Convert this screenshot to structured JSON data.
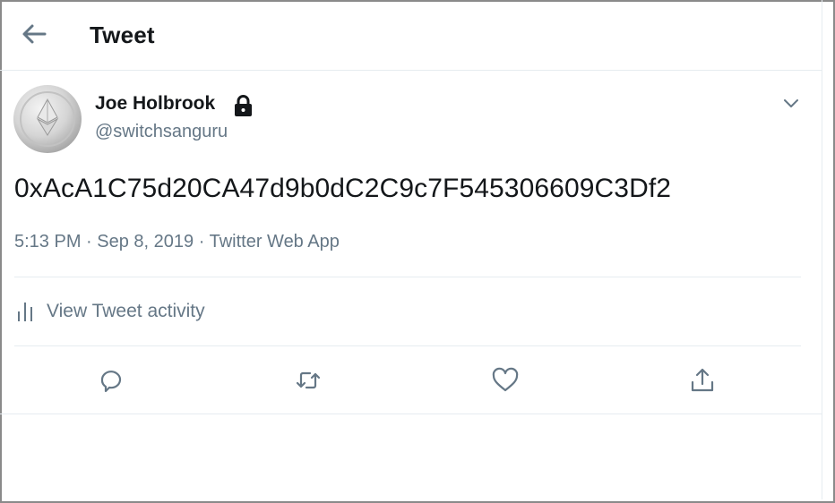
{
  "header": {
    "back_icon": "arrow-left-icon",
    "title": "Tweet"
  },
  "tweet": {
    "author_name": "Joe Holbrook",
    "author_handle": "@switchsanguru",
    "protected_icon": "lock-icon",
    "avatar_icon": "ethereum-coin-avatar",
    "menu_icon": "chevron-down-icon",
    "text": "0xAcA1C75d20CA47d9b0dC2C9c7F545306609C3Df2",
    "time": "5:13 PM",
    "separator": "·",
    "date": "Sep 8, 2019",
    "source": "Twitter Web App"
  },
  "activity": {
    "icon": "bar-chart-icon",
    "label": "View Tweet activity"
  },
  "actions": [
    {
      "name": "reply",
      "icon": "reply-icon"
    },
    {
      "name": "retweet",
      "icon": "retweet-icon"
    },
    {
      "name": "like",
      "icon": "heart-icon"
    },
    {
      "name": "share",
      "icon": "share-icon"
    }
  ],
  "colors": {
    "text": "#14171a",
    "secondary": "#657786",
    "divider": "#e6ecf0",
    "accent": "#1da1f2"
  }
}
